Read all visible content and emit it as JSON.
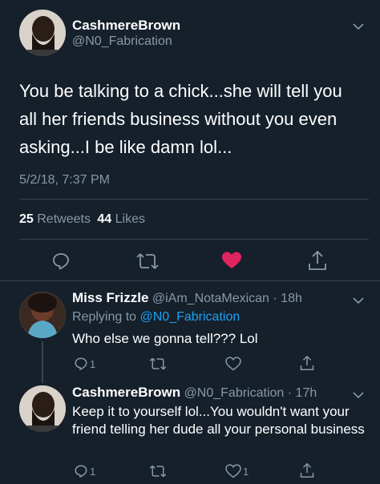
{
  "main_tweet": {
    "display_name": "CashmereBrown",
    "handle": "@N0_Fabrication",
    "text": "You be talking to a chick...she will tell you all her friends business without you even asking...I be like damn lol...",
    "timestamp": "5/2/18, 7:37 PM",
    "retweets_count": "25",
    "retweets_label": "Retweets",
    "likes_count": "44",
    "likes_label": "Likes",
    "like_color": "#e0245e"
  },
  "replies": [
    {
      "display_name": "Miss Frizzle",
      "handle": "@iAm_NotaMexican",
      "time": "· 18h",
      "replying_label": "Replying to",
      "replying_handle": "@N0_Fabrication",
      "text": "Who else we gonna tell??? Lol",
      "reply_count": "1"
    },
    {
      "display_name": "CashmereBrown",
      "handle": "@N0_Fabrication",
      "time": "· 17h",
      "text": "Keep it to yourself lol...You wouldn't want your friend telling her dude all your personal business",
      "reply_count": "1",
      "like_count": "1"
    }
  ],
  "icons": [
    "reply-icon",
    "retweet-icon",
    "heart-icon",
    "share-icon",
    "chevron-down-icon"
  ],
  "colors": {
    "background": "#15202b",
    "text_muted": "#8899a6",
    "link": "#1da1f2",
    "divider": "#38444d"
  }
}
